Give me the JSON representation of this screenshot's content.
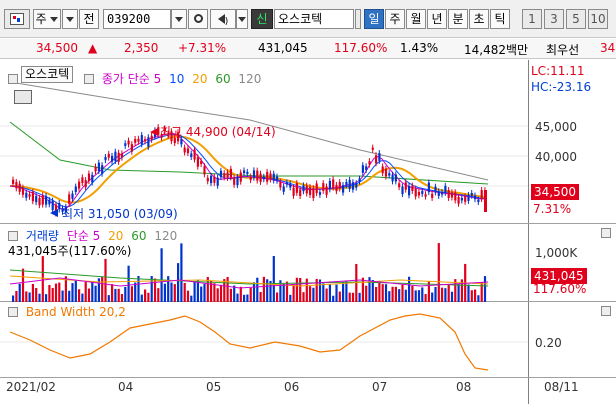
{
  "toolbar": {
    "menu_label": "주",
    "type_label": "전",
    "code": "039200",
    "search_icon": "magnifier-icon",
    "sound_icon": "speaker-icon",
    "new_badge": "신",
    "stock_name": "오스코텍",
    "periods": [
      "일",
      "주",
      "월",
      "년",
      "분",
      "초",
      "틱"
    ],
    "active_period": "일",
    "intervals": [
      "1",
      "3",
      "5",
      "10"
    ]
  },
  "quote": {
    "price": "34,500",
    "change_sign": "▲",
    "change": "2,350",
    "change_pct": "+7.31%",
    "volume": "431,045",
    "vol_ratio": "117.60%",
    "turnover": "1.43%",
    "amount": "14,482백만",
    "priority": "최우선",
    "priority_value": "34"
  },
  "price_pane": {
    "legend_name": "오스코텍",
    "legend_ma": "종가 단순 5",
    "ma_periods": [
      "10",
      "20",
      "60",
      "120"
    ],
    "lc_label": "LC:11.11",
    "hc_label": "HC:-23.16",
    "y_ticks": [
      "45,000",
      "40,000",
      "35,000"
    ],
    "current_price_tag": "34,500",
    "current_pct_tag": "7.31%",
    "high_annotation": "최고 44,900 (04/14)",
    "low_annotation": "최저 31,050 (03/09)"
  },
  "volume_pane": {
    "legend_name": "거래량",
    "legend_ma": "단순 5",
    "ma_periods": [
      "20",
      "60",
      "120"
    ],
    "value_text": "431,045주(117.60%)",
    "y_tick": "1,000K",
    "current_volume_tag": "431,045",
    "current_ratio_tag": "117.60%"
  },
  "bw_pane": {
    "legend": "Band Width 20,2",
    "y_tick": "0.20"
  },
  "x_axis": {
    "labels": [
      "2021/02",
      "04",
      "05",
      "06",
      "07",
      "08"
    ],
    "end_date": "08/11"
  },
  "colors": {
    "up": "#e0001b",
    "down": "#0033cc",
    "ma5": "#cc00cc",
    "ma10": "#0050ff",
    "ma20": "#f0a000",
    "ma60": "#2a9a2a",
    "ma120": "#8a8a8a",
    "bandwidth": "#f07800"
  }
}
